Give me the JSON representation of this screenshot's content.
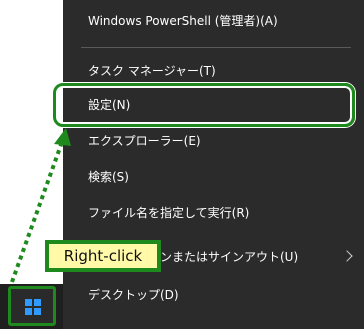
{
  "context_menu": {
    "items": [
      {
        "label": "Windows PowerShell (管理者)(A)"
      },
      {
        "label": "タスク マネージャー(T)"
      },
      {
        "label": "設定(N)"
      },
      {
        "label": "エクスプローラー(E)"
      },
      {
        "label": "検索(S)"
      },
      {
        "label": "ファイル名を指定して実行(R)"
      },
      {
        "label": "シャットダウンまたはサインアウト(U)"
      },
      {
        "label": "デスクトップ(D)"
      }
    ]
  },
  "annotation": {
    "callout_text": "Right-click",
    "highlight_color": "#1e8a1e",
    "callout_bg": "#fff9a8"
  },
  "taskbar": {
    "start_icon": "windows-logo-icon",
    "start_icon_color": "#2f9bff"
  }
}
